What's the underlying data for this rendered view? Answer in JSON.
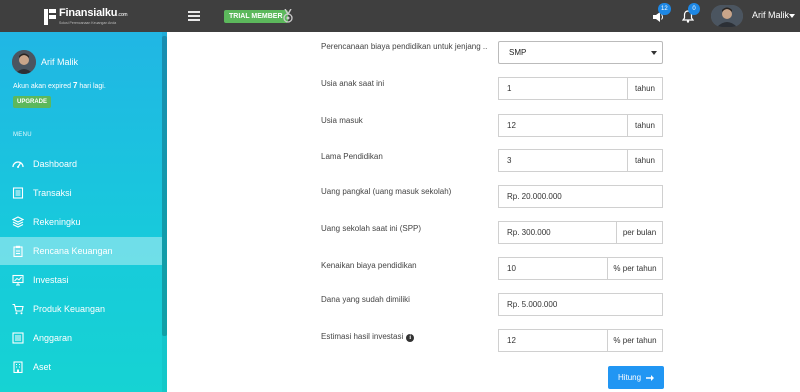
{
  "header": {
    "logo_name": "Finansialku",
    "logo_suffix": ".com",
    "logo_tagline": "Solusi Perencanaan Keuangan Anda",
    "trial_badge": "TRIAL MEMBER",
    "notif_count": "12",
    "bell_count": "0",
    "username": "Arif Malik"
  },
  "sidebar": {
    "username": "Arif Malik",
    "expiry_prefix": "Akun akan expired ",
    "expiry_days": "7",
    "expiry_suffix": " hari lagi.",
    "upgrade_label": "UPGRADE",
    "menu_label": "MENU",
    "items": [
      {
        "label": "Dashboard",
        "icon": "speedometer-icon"
      },
      {
        "label": "Transaksi",
        "icon": "transaction-icon"
      },
      {
        "label": "Rekeningku",
        "icon": "layers-icon"
      },
      {
        "label": "Rencana Keuangan",
        "icon": "clipboard-icon",
        "active": true
      },
      {
        "label": "Investasi",
        "icon": "monitor-chart-icon"
      },
      {
        "label": "Produk Keuangan",
        "icon": "cart-icon"
      },
      {
        "label": "Anggaran",
        "icon": "list-icon"
      },
      {
        "label": "Aset",
        "icon": "building-icon"
      }
    ]
  },
  "form": {
    "level": {
      "label": "Perencanaan biaya pendidikan untuk jenjang ..",
      "value": "SMP"
    },
    "child_age": {
      "label": "Usia anak saat ini",
      "value": "1",
      "unit": "tahun"
    },
    "entry_age": {
      "label": "Usia masuk",
      "value": "12",
      "unit": "tahun"
    },
    "duration": {
      "label": "Lama Pendidikan",
      "value": "3",
      "unit": "tahun"
    },
    "entry_fee": {
      "label": "Uang pangkal (uang masuk sekolah)",
      "value": "Rp. 20.000.000"
    },
    "monthly_fee": {
      "label": "Uang sekolah saat ini (SPP)",
      "value": "Rp. 300.000",
      "unit": "per bulan"
    },
    "increase": {
      "label": "Kenaikan biaya pendidikan",
      "value": "10",
      "unit": "% per tahun"
    },
    "owned_funds": {
      "label": "Dana yang sudah dimiliki",
      "value": "Rp. 5.000.000"
    },
    "investment": {
      "label": "Estimasi hasil investasi",
      "value": "12",
      "unit": "% per tahun"
    },
    "submit_label": "Hitung"
  },
  "colors": {
    "topbar": "#3f3f3f",
    "sidebar_start": "#21b6e4",
    "sidebar_end": "#16d3d3",
    "badge_green": "#5cb85c",
    "primary": "#2196f3"
  }
}
